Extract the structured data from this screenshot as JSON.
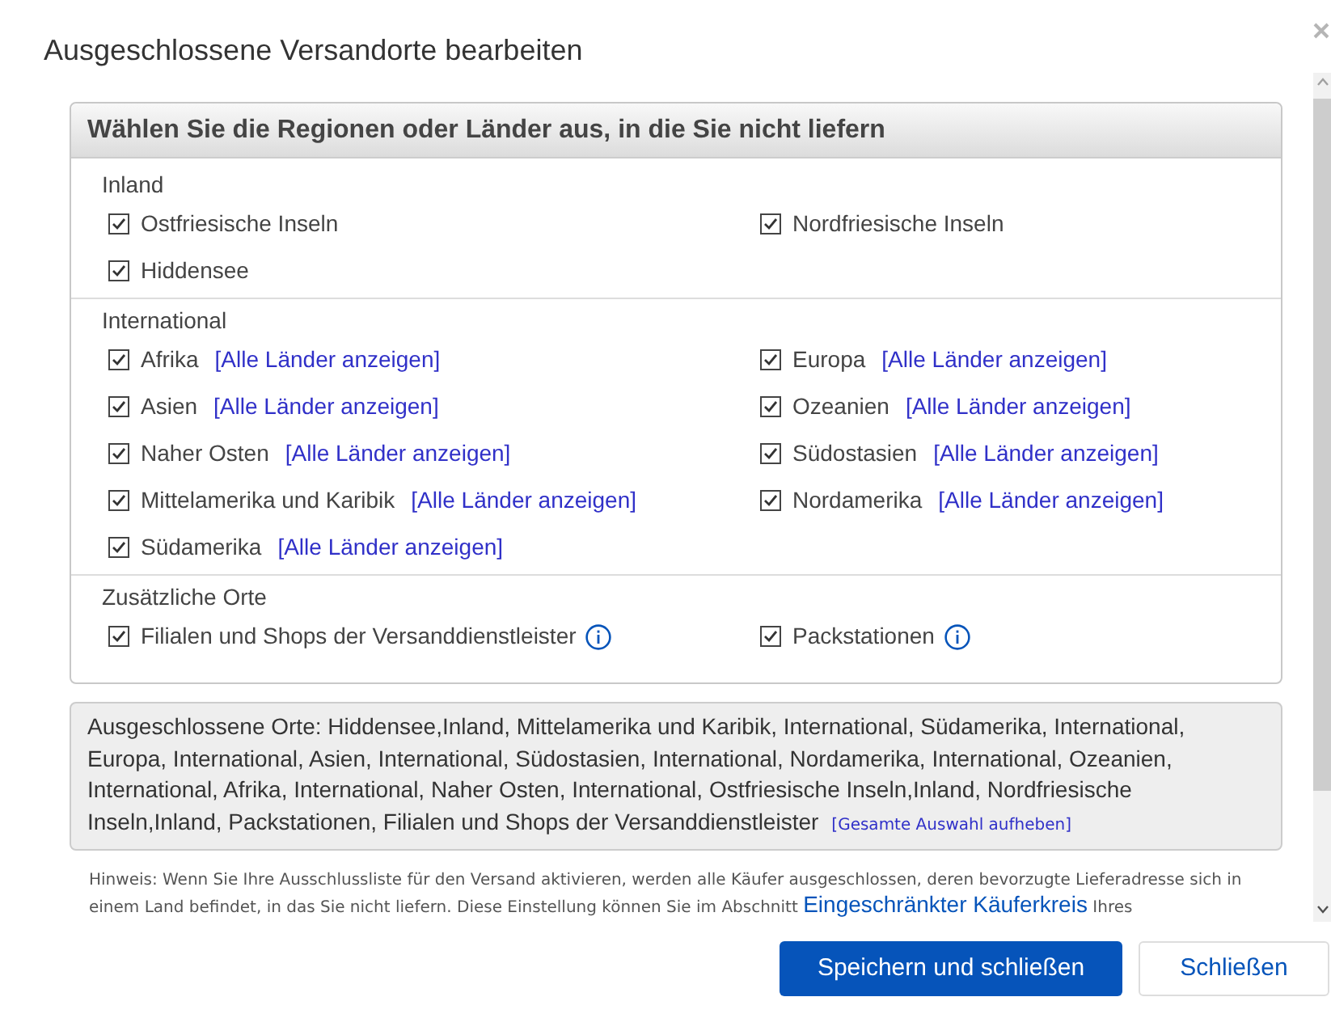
{
  "dialog": {
    "title": "Ausgeschlossene Versandorte bearbeiten"
  },
  "panel": {
    "heading": "Wählen Sie die Regionen oder Länder aus, in die Sie nicht liefern",
    "sections": [
      {
        "label": "Inland",
        "items": [
          {
            "label": "Ostfriesische Inseln",
            "checked": true
          },
          {
            "label": "Nordfriesische Inseln",
            "checked": true
          },
          {
            "label": "Hiddensee",
            "checked": true
          }
        ]
      },
      {
        "label": "International",
        "items": [
          {
            "label": "Afrika",
            "checked": true,
            "link": "[Alle Länder anzeigen]"
          },
          {
            "label": "Europa",
            "checked": true,
            "link": "[Alle Länder anzeigen]"
          },
          {
            "label": "Asien",
            "checked": true,
            "link": "[Alle Länder anzeigen]"
          },
          {
            "label": "Ozeanien",
            "checked": true,
            "link": "[Alle Länder anzeigen]"
          },
          {
            "label": "Naher Osten",
            "checked": true,
            "link": "[Alle Länder anzeigen]"
          },
          {
            "label": "Südostasien",
            "checked": true,
            "link": "[Alle Länder anzeigen]"
          },
          {
            "label": "Mittelamerika und Karibik",
            "checked": true,
            "link": "[Alle Länder anzeigen]"
          },
          {
            "label": "Nordamerika",
            "checked": true,
            "link": "[Alle Länder anzeigen]"
          },
          {
            "label": "Südamerika",
            "checked": true,
            "link": "[Alle Länder anzeigen]"
          }
        ]
      },
      {
        "label": "Zusätzliche Orte",
        "items": [
          {
            "label": "Filialen und Shops der Versanddienstleister",
            "checked": true,
            "info": true
          },
          {
            "label": "Packstationen",
            "checked": true,
            "info": true
          }
        ]
      }
    ]
  },
  "summary": {
    "label": "Ausgeschlossene Orte:",
    "text": "Hiddensee,Inland, Mittelamerika und Karibik, International, Südamerika, International, Europa, International, Asien, International, Südostasien, International, Nordamerika, International, Ozeanien, International, Afrika, International, Naher Osten, International, Ostfriesische Inseln,Inland, Nordfriesische Inseln,Inland, Packstationen, Filialen und Shops der Versanddienstleister",
    "link": "[Gesamte Auswahl aufheben]"
  },
  "hint": {
    "text": "Hinweis: Wenn Sie Ihre Ausschlussliste für den Versand aktivieren, werden alle Käufer ausgeschlossen, deren bevorzugte Lieferadresse sich in einem Land befindet, in das Sie nicht liefern. Diese Einstellung können Sie im Abschnitt",
    "link": "Eingeschränkter Käuferkreis",
    "after": "Ihres"
  },
  "buttons": [
    {
      "label": "Speichern und schließen",
      "kind": "primary"
    },
    {
      "label": "Schließen",
      "kind": "secondary"
    }
  ]
}
